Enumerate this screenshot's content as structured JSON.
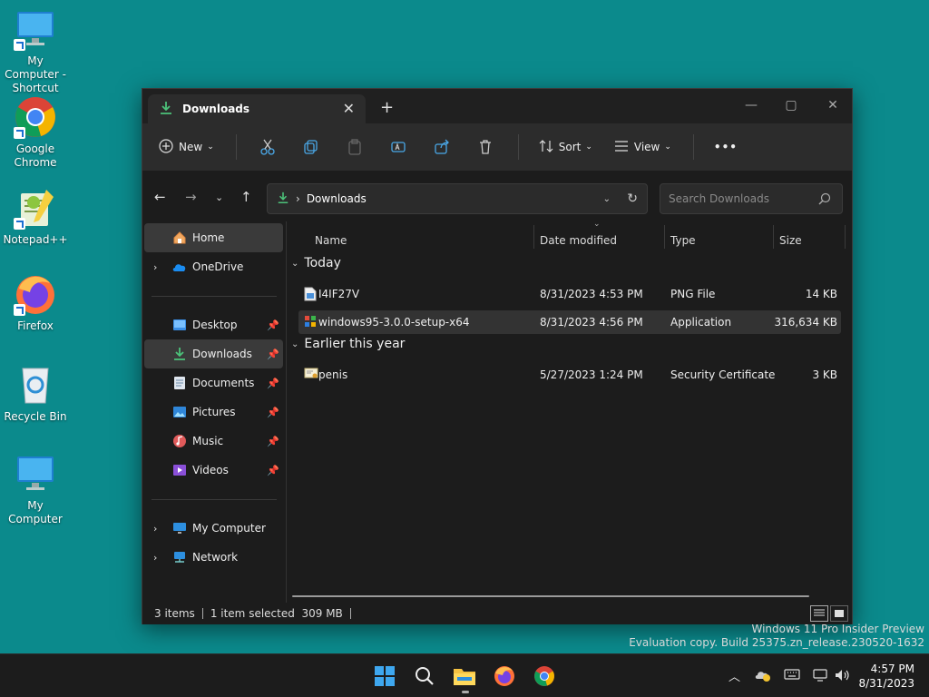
{
  "desktop": {
    "icons": [
      {
        "label": "My Computer - Shortcut",
        "icon": "monitor-icon"
      },
      {
        "label": "Google Chrome",
        "icon": "chrome-icon"
      },
      {
        "label": "Notepad++",
        "icon": "notepadpp-icon"
      },
      {
        "label": "Firefox",
        "icon": "firefox-icon"
      },
      {
        "label": "Recycle Bin",
        "icon": "recycle-bin-icon"
      },
      {
        "label": "My Computer",
        "icon": "monitor-icon"
      }
    ]
  },
  "window": {
    "tab_title": "Downloads",
    "toolbar": {
      "new_label": "New",
      "sort_label": "Sort",
      "view_label": "View",
      "more_label": "•••"
    },
    "address": {
      "crumb": "Downloads",
      "search_placeholder": "Search Downloads"
    },
    "sidebar": {
      "home": "Home",
      "onedrive": "OneDrive",
      "quick_access": [
        {
          "label": "Desktop",
          "icon": "desktop-folder-icon"
        },
        {
          "label": "Downloads",
          "icon": "download-icon"
        },
        {
          "label": "Documents",
          "icon": "documents-icon"
        },
        {
          "label": "Pictures",
          "icon": "pictures-icon"
        },
        {
          "label": "Music",
          "icon": "music-icon"
        },
        {
          "label": "Videos",
          "icon": "videos-icon"
        }
      ],
      "my_computer": "My Computer",
      "network": "Network"
    },
    "columns": {
      "name": "Name",
      "date": "Date modified",
      "type": "Type",
      "size": "Size"
    },
    "groups": [
      {
        "title": "Today",
        "files": [
          {
            "name": "I4IF27V",
            "date": "8/31/2023 4:53 PM",
            "type": "PNG File",
            "size": "14 KB",
            "icon": "image-file-icon"
          },
          {
            "name": "windows95-3.0.0-setup-x64",
            "date": "8/31/2023 4:56 PM",
            "type": "Application",
            "size": "316,634 KB",
            "icon": "application-file-icon"
          }
        ]
      },
      {
        "title": "Earlier this year",
        "files": [
          {
            "name": "penis",
            "date": "5/27/2023 1:24 PM",
            "type": "Security Certificate",
            "size": "3 KB",
            "icon": "certificate-file-icon"
          }
        ]
      }
    ],
    "status": {
      "count": "3 items",
      "selection": "1 item selected  309 MB"
    }
  },
  "watermark": {
    "line1": "Windows 11 Pro Insider Preview",
    "line2": "Evaluation copy. Build 25375.zn_release.230520-1632"
  },
  "taskbar": {
    "time": "4:57 PM",
    "date": "8/31/2023"
  },
  "colors": {
    "desktop_bg": "#0b8a8c",
    "window_bg": "#1c1c1c",
    "accent_download": "#4cc27a"
  }
}
